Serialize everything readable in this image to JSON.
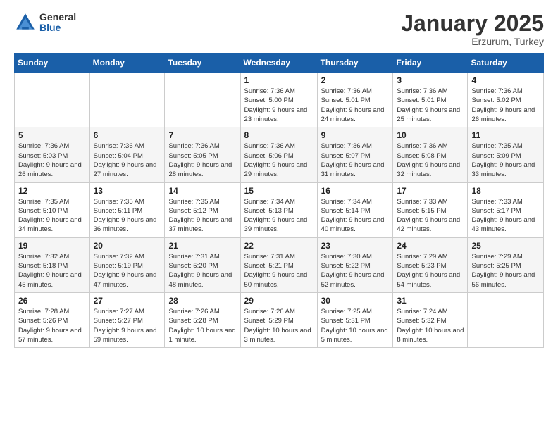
{
  "logo": {
    "general": "General",
    "blue": "Blue"
  },
  "title": {
    "month": "January 2025",
    "location": "Erzurum, Turkey"
  },
  "weekdays": [
    "Sunday",
    "Monday",
    "Tuesday",
    "Wednesday",
    "Thursday",
    "Friday",
    "Saturday"
  ],
  "weeks": [
    [
      {
        "day": "",
        "info": ""
      },
      {
        "day": "",
        "info": ""
      },
      {
        "day": "",
        "info": ""
      },
      {
        "day": "1",
        "info": "Sunrise: 7:36 AM\nSunset: 5:00 PM\nDaylight: 9 hours\nand 23 minutes."
      },
      {
        "day": "2",
        "info": "Sunrise: 7:36 AM\nSunset: 5:01 PM\nDaylight: 9 hours\nand 24 minutes."
      },
      {
        "day": "3",
        "info": "Sunrise: 7:36 AM\nSunset: 5:01 PM\nDaylight: 9 hours\nand 25 minutes."
      },
      {
        "day": "4",
        "info": "Sunrise: 7:36 AM\nSunset: 5:02 PM\nDaylight: 9 hours\nand 26 minutes."
      }
    ],
    [
      {
        "day": "5",
        "info": "Sunrise: 7:36 AM\nSunset: 5:03 PM\nDaylight: 9 hours\nand 26 minutes."
      },
      {
        "day": "6",
        "info": "Sunrise: 7:36 AM\nSunset: 5:04 PM\nDaylight: 9 hours\nand 27 minutes."
      },
      {
        "day": "7",
        "info": "Sunrise: 7:36 AM\nSunset: 5:05 PM\nDaylight: 9 hours\nand 28 minutes."
      },
      {
        "day": "8",
        "info": "Sunrise: 7:36 AM\nSunset: 5:06 PM\nDaylight: 9 hours\nand 29 minutes."
      },
      {
        "day": "9",
        "info": "Sunrise: 7:36 AM\nSunset: 5:07 PM\nDaylight: 9 hours\nand 31 minutes."
      },
      {
        "day": "10",
        "info": "Sunrise: 7:36 AM\nSunset: 5:08 PM\nDaylight: 9 hours\nand 32 minutes."
      },
      {
        "day": "11",
        "info": "Sunrise: 7:35 AM\nSunset: 5:09 PM\nDaylight: 9 hours\nand 33 minutes."
      }
    ],
    [
      {
        "day": "12",
        "info": "Sunrise: 7:35 AM\nSunset: 5:10 PM\nDaylight: 9 hours\nand 34 minutes."
      },
      {
        "day": "13",
        "info": "Sunrise: 7:35 AM\nSunset: 5:11 PM\nDaylight: 9 hours\nand 36 minutes."
      },
      {
        "day": "14",
        "info": "Sunrise: 7:35 AM\nSunset: 5:12 PM\nDaylight: 9 hours\nand 37 minutes."
      },
      {
        "day": "15",
        "info": "Sunrise: 7:34 AM\nSunset: 5:13 PM\nDaylight: 9 hours\nand 39 minutes."
      },
      {
        "day": "16",
        "info": "Sunrise: 7:34 AM\nSunset: 5:14 PM\nDaylight: 9 hours\nand 40 minutes."
      },
      {
        "day": "17",
        "info": "Sunrise: 7:33 AM\nSunset: 5:15 PM\nDaylight: 9 hours\nand 42 minutes."
      },
      {
        "day": "18",
        "info": "Sunrise: 7:33 AM\nSunset: 5:17 PM\nDaylight: 9 hours\nand 43 minutes."
      }
    ],
    [
      {
        "day": "19",
        "info": "Sunrise: 7:32 AM\nSunset: 5:18 PM\nDaylight: 9 hours\nand 45 minutes."
      },
      {
        "day": "20",
        "info": "Sunrise: 7:32 AM\nSunset: 5:19 PM\nDaylight: 9 hours\nand 47 minutes."
      },
      {
        "day": "21",
        "info": "Sunrise: 7:31 AM\nSunset: 5:20 PM\nDaylight: 9 hours\nand 48 minutes."
      },
      {
        "day": "22",
        "info": "Sunrise: 7:31 AM\nSunset: 5:21 PM\nDaylight: 9 hours\nand 50 minutes."
      },
      {
        "day": "23",
        "info": "Sunrise: 7:30 AM\nSunset: 5:22 PM\nDaylight: 9 hours\nand 52 minutes."
      },
      {
        "day": "24",
        "info": "Sunrise: 7:29 AM\nSunset: 5:23 PM\nDaylight: 9 hours\nand 54 minutes."
      },
      {
        "day": "25",
        "info": "Sunrise: 7:29 AM\nSunset: 5:25 PM\nDaylight: 9 hours\nand 56 minutes."
      }
    ],
    [
      {
        "day": "26",
        "info": "Sunrise: 7:28 AM\nSunset: 5:26 PM\nDaylight: 9 hours\nand 57 minutes."
      },
      {
        "day": "27",
        "info": "Sunrise: 7:27 AM\nSunset: 5:27 PM\nDaylight: 9 hours\nand 59 minutes."
      },
      {
        "day": "28",
        "info": "Sunrise: 7:26 AM\nSunset: 5:28 PM\nDaylight: 10 hours\nand 1 minute."
      },
      {
        "day": "29",
        "info": "Sunrise: 7:26 AM\nSunset: 5:29 PM\nDaylight: 10 hours\nand 3 minutes."
      },
      {
        "day": "30",
        "info": "Sunrise: 7:25 AM\nSunset: 5:31 PM\nDaylight: 10 hours\nand 5 minutes."
      },
      {
        "day": "31",
        "info": "Sunrise: 7:24 AM\nSunset: 5:32 PM\nDaylight: 10 hours\nand 8 minutes."
      },
      {
        "day": "",
        "info": ""
      }
    ]
  ]
}
